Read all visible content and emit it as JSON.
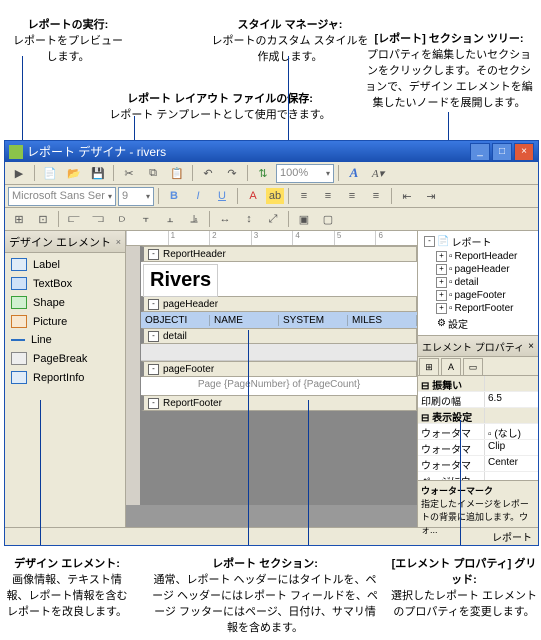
{
  "callouts": {
    "run_title": "レポートの実行:",
    "run_body": "レポートをプレビューします。",
    "style_title": "スタイル マネージャ:",
    "style_body": "レポートのカスタム スタイルを作成します。",
    "tree_title": "[レポート] セクション ツリー:",
    "tree_body": "プロパティを編集したいセクションをクリックします。そのセクションで、デザイン エレメントを編集したいノードを展開します。",
    "save_title": "レポート レイアウト ファイルの保存:",
    "save_body": "レポート テンプレートとして使用できます。",
    "design_title": "デザイン エレメント:",
    "design_body": "画像情報、テキスト情報、レポート情報を含むレポートを改良します。",
    "sections_title": "レポート セクション:",
    "sections_body": "通常、レポート ヘッダーにはタイトルを、ページ ヘッダーにはレポート フィールドを、ページ フッターにはページ、日付け、サマリ情報を含めます。",
    "propgrid_title": "[エレメント プロパティ] グリッド:",
    "propgrid_body": "選択したレポート エレメントのプロパティを変更します。"
  },
  "window": {
    "title": "レポート デザイナ - rivers"
  },
  "toolbar2": {
    "font": "Microsoft Sans Ser",
    "size": "9",
    "zoom": "100%"
  },
  "leftpanel": {
    "title": "デザイン エレメント",
    "items": [
      {
        "label": "Label",
        "icon": "ico-label"
      },
      {
        "label": "TextBox",
        "icon": "ico-textbox"
      },
      {
        "label": "Shape",
        "icon": "ico-shape"
      },
      {
        "label": "Picture",
        "icon": "ico-picture"
      },
      {
        "label": "Line",
        "icon": "ico-line"
      },
      {
        "label": "PageBreak",
        "icon": "ico-pagebreak"
      },
      {
        "label": "ReportInfo",
        "icon": "ico-reportinfo"
      }
    ]
  },
  "sections": {
    "reportHeader": "ReportHeader",
    "pageHeader": "pageHeader",
    "detail": "detail",
    "pageFooter": "pageFooter",
    "reportFooter": "ReportFooter",
    "rivers": "Rivers",
    "cols": [
      "OBJECTI",
      "NAME",
      "SYSTEM",
      "MILES"
    ],
    "pageNum": "Page {PageNumber} of {PageCount}"
  },
  "tree": {
    "root": "レポート",
    "nodes": [
      "ReportHeader",
      "pageHeader",
      "detail",
      "pageFooter",
      "ReportFooter"
    ],
    "settings": "設定"
  },
  "prop": {
    "title": "エレメント プロパティ",
    "grp1": "振舞い",
    "printWidthK": "印刷の幅",
    "printWidthV": "6.5",
    "grp2": "表示設定",
    "wm1k": "ウォータマ",
    "wm1v": "(なし)",
    "wm2k": "ウォータマ",
    "wm2v": "Clip",
    "wm3k": "ウォータマ",
    "wm3v": "Center",
    "wm4k": "ページにウ",
    "wm4v": "",
    "helpTitle": "ウォーターマーク",
    "helpBody": "指定したイメージをレポートの背景に追加します。ウォ..."
  },
  "status": "レポート"
}
